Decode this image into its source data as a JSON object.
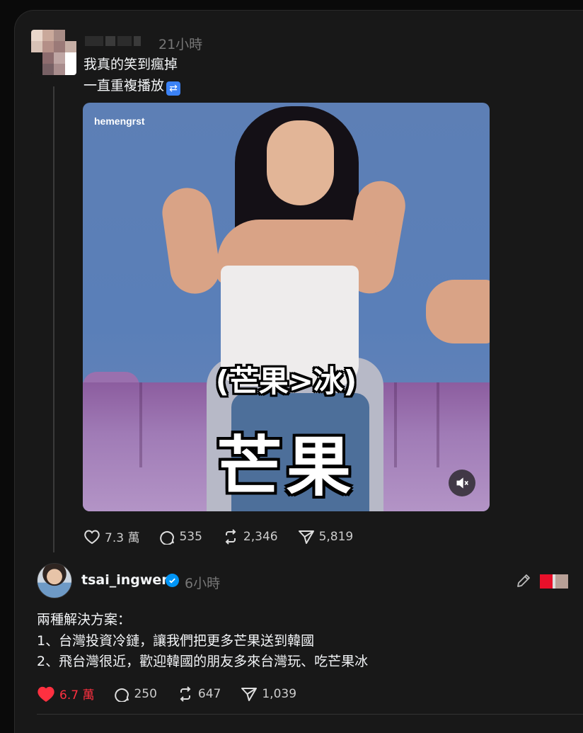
{
  "post1": {
    "time": "21小時",
    "lines": [
      "我真的笑到瘋掉",
      "一直重複播放"
    ],
    "repost_emoji": "repost-arrows-icon",
    "video": {
      "watermark": "hemengrst",
      "subtitle_small": "(芒果>冰)",
      "subtitle_big": "芒果",
      "mute_icon": "muted-speaker-icon"
    },
    "actions": {
      "likes": "7.3 萬",
      "comments": "535",
      "reposts": "2,346",
      "shares": "5,819"
    }
  },
  "post2": {
    "username": "tsai_ingwen",
    "time": "6小時",
    "verified_icon": "verified-badge-icon",
    "lines": [
      "兩種解決方案：",
      "1、台灣投資冷鏈，讓我們把更多芒果送到韓國",
      "2、飛台灣很近，歡迎韓國的朋友多來台灣玩、吃芒果冰"
    ],
    "actions": {
      "likes": "6.7 萬",
      "comments": "250",
      "reposts": "647",
      "shares": "1,039"
    }
  },
  "colors": {
    "background": "#181818",
    "text": "#f3f5f7",
    "muted": "#777777",
    "liked_red": "#ff3040",
    "verified_blue": "#0095f6"
  }
}
